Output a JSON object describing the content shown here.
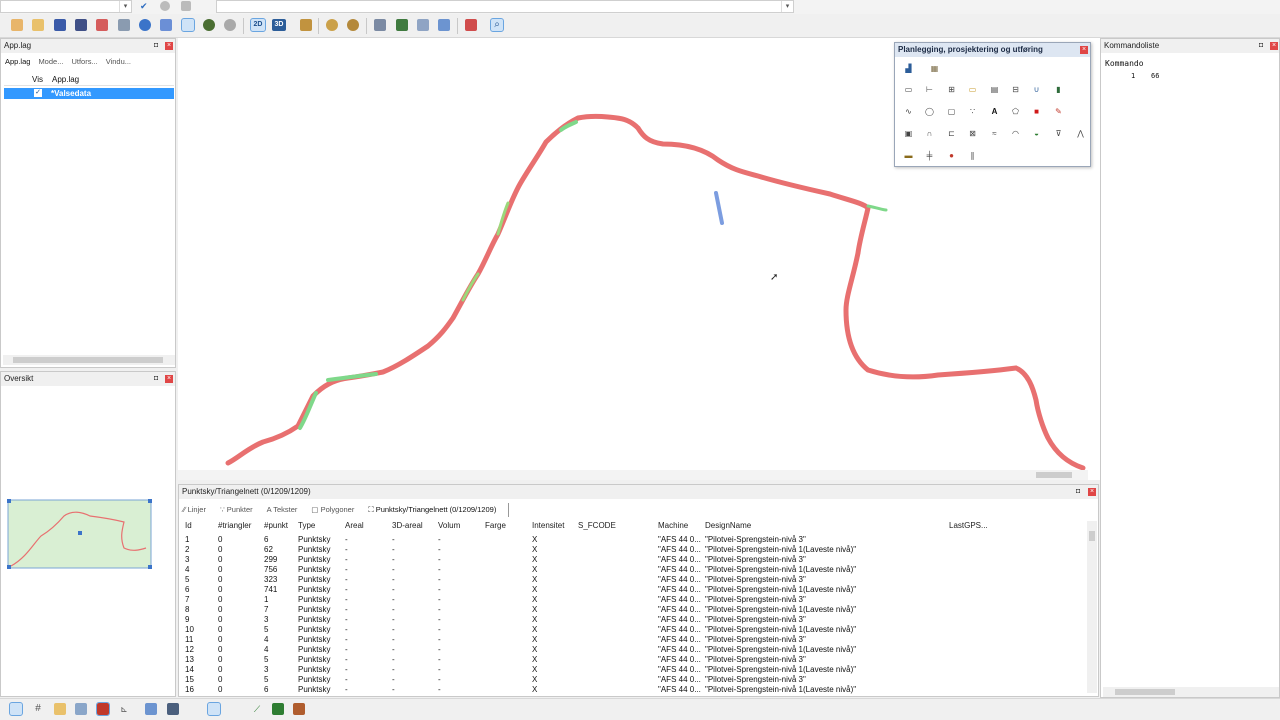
{
  "app_layers_panel": {
    "title": "App.lag",
    "tabs": [
      "App.lag",
      "Mode...",
      "Utfors...",
      "Vindu..."
    ],
    "columns": [
      "Vis",
      "App.lag"
    ],
    "rows": [
      {
        "checked": true,
        "label": "*Valsedata"
      }
    ]
  },
  "overview_panel": {
    "title": "Oversikt"
  },
  "toolbox": {
    "title": "Planlegging, prosjektering og utføring"
  },
  "command_panel": {
    "title": "Kommandoliste",
    "header": "Kommando",
    "rows": [
      {
        "num": "1",
        "value": "66"
      }
    ]
  },
  "table_panel": {
    "title": "Punktsky/Triangelnett (0/1209/1209)",
    "tabs": [
      "Linjer",
      "Punkter",
      "Tekster",
      "Polygoner",
      "Punktsky/Triangelnett (0/1209/1209)"
    ],
    "columns": [
      "Id",
      "#triangler",
      "#punkt",
      "Type",
      "Areal",
      "3D-areal",
      "Volum",
      "Farge",
      "Intensitet",
      "S_FCODE",
      "Machine",
      "DesignName",
      "LastGPS..."
    ],
    "rows": [
      [
        "1",
        "0",
        "6",
        "Punktsky",
        "-",
        "-",
        "-",
        "",
        "X",
        "",
        "\"AFS 44 0...",
        "\"Pilotvei-Sprengstein-nivå 3\"",
        ""
      ],
      [
        "2",
        "0",
        "62",
        "Punktsky",
        "-",
        "-",
        "-",
        "",
        "X",
        "",
        "\"AFS 44 0...",
        "\"Pilotvei-Sprengstein-nivå 1(Laveste nivå)\"",
        ""
      ],
      [
        "3",
        "0",
        "299",
        "Punktsky",
        "-",
        "-",
        "-",
        "",
        "X",
        "",
        "\"AFS 44 0...",
        "\"Pilotvei-Sprengstein-nivå 3\"",
        ""
      ],
      [
        "4",
        "0",
        "756",
        "Punktsky",
        "-",
        "-",
        "-",
        "",
        "X",
        "",
        "\"AFS 44 0...",
        "\"Pilotvei-Sprengstein-nivå 1(Laveste nivå)\"",
        ""
      ],
      [
        "5",
        "0",
        "323",
        "Punktsky",
        "-",
        "-",
        "-",
        "",
        "X",
        "",
        "\"AFS 44 0...",
        "\"Pilotvei-Sprengstein-nivå 3\"",
        ""
      ],
      [
        "6",
        "0",
        "741",
        "Punktsky",
        "-",
        "-",
        "-",
        "",
        "X",
        "",
        "\"AFS 44 0...",
        "\"Pilotvei-Sprengstein-nivå 1(Laveste nivå)\"",
        ""
      ],
      [
        "7",
        "0",
        "1",
        "Punktsky",
        "-",
        "-",
        "-",
        "",
        "X",
        "",
        "\"AFS 44 0...",
        "\"Pilotvei-Sprengstein-nivå 3\"",
        ""
      ],
      [
        "8",
        "0",
        "7",
        "Punktsky",
        "-",
        "-",
        "-",
        "",
        "X",
        "",
        "\"AFS 44 0...",
        "\"Pilotvei-Sprengstein-nivå 1(Laveste nivå)\"",
        ""
      ],
      [
        "9",
        "0",
        "3",
        "Punktsky",
        "-",
        "-",
        "-",
        "",
        "X",
        "",
        "\"AFS 44 0...",
        "\"Pilotvei-Sprengstein-nivå 3\"",
        ""
      ],
      [
        "10",
        "0",
        "5",
        "Punktsky",
        "-",
        "-",
        "-",
        "",
        "X",
        "",
        "\"AFS 44 0...",
        "\"Pilotvei-Sprengstein-nivå 1(Laveste nivå)\"",
        ""
      ],
      [
        "11",
        "0",
        "4",
        "Punktsky",
        "-",
        "-",
        "-",
        "",
        "X",
        "",
        "\"AFS 44 0...",
        "\"Pilotvei-Sprengstein-nivå 3\"",
        ""
      ],
      [
        "12",
        "0",
        "4",
        "Punktsky",
        "-",
        "-",
        "-",
        "",
        "X",
        "",
        "\"AFS 44 0...",
        "\"Pilotvei-Sprengstein-nivå 1(Laveste nivå)\"",
        ""
      ],
      [
        "13",
        "0",
        "5",
        "Punktsky",
        "-",
        "-",
        "-",
        "",
        "X",
        "",
        "\"AFS 44 0...",
        "\"Pilotvei-Sprengstein-nivå 3\"",
        ""
      ],
      [
        "14",
        "0",
        "3",
        "Punktsky",
        "-",
        "-",
        "-",
        "",
        "X",
        "",
        "\"AFS 44 0...",
        "\"Pilotvei-Sprengstein-nivå 1(Laveste nivå)\"",
        ""
      ],
      [
        "15",
        "0",
        "5",
        "Punktsky",
        "-",
        "-",
        "-",
        "",
        "X",
        "",
        "\"AFS 44 0...",
        "\"Pilotvei-Sprengstein-nivå 3\"",
        ""
      ],
      [
        "16",
        "0",
        "6",
        "Punktsky",
        "-",
        "-",
        "-",
        "",
        "X",
        "",
        "\"AFS 44 0...",
        "\"Pilotvei-Sprengstein-nivå 1(Laveste nivå)\"",
        ""
      ]
    ]
  },
  "toolbar": {
    "toggle_2d": "2D",
    "toggle_3d": "3D"
  },
  "colors": {
    "selection": "#3399ff",
    "road_red": "#e87070",
    "road_green": "#7fd88a",
    "overview_fill": "#d9efd3",
    "close": "#e04646"
  }
}
